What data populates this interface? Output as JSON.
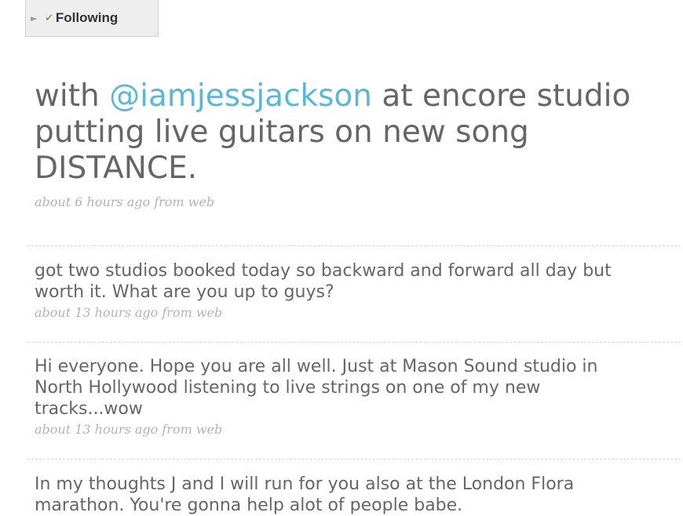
{
  "follow": {
    "label": "Following"
  },
  "featured": {
    "text_before": "with ",
    "mention": "@iamjessjackson",
    "text_after": " at encore studio putting live guitars on new song DISTANCE.",
    "meta": "about 6 hours ago from web"
  },
  "statuses": [
    {
      "text": "got two studios booked today so backward and forward all day but worth it. What are you up to guys?",
      "meta": "about 13 hours ago from web"
    },
    {
      "text": "Hi everyone. Hope you are all well. Just at Mason Sound studio in North Hollywood listening to live strings on one of my new tracks...wow",
      "meta": "about 13 hours ago from web"
    },
    {
      "text": "In my thoughts J and I will run for you also at the London Flora marathon. You're gonna help alot of people babe."
    }
  ],
  "colors": {
    "mention": "#5bb7d6",
    "text": "#666666",
    "meta": "#b3b3b3",
    "check": "#6fb24a"
  }
}
